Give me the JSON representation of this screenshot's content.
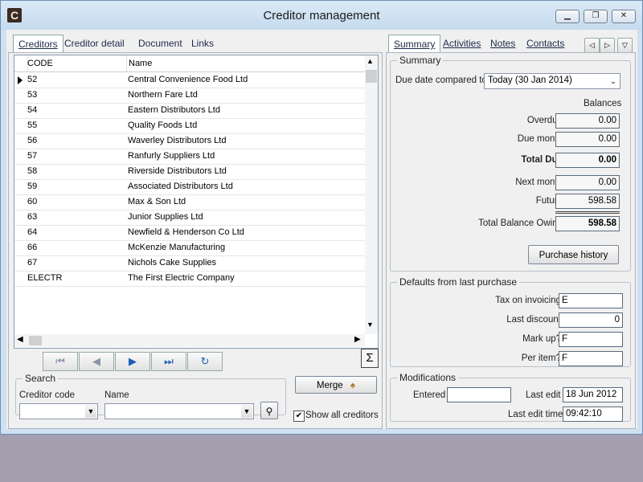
{
  "window": {
    "title": "Creditor management",
    "app_icon": "C",
    "icons": [
      "app-icon",
      "minimize-icon",
      "restore-icon",
      "close-icon"
    ]
  },
  "left_tabs": [
    "Creditors",
    "Creditor detail",
    "Document",
    "Links"
  ],
  "grid": {
    "columns": [
      "CODE",
      "Name"
    ],
    "rows": [
      {
        "code": "52",
        "name": "Central Convenience Food Ltd"
      },
      {
        "code": "53",
        "name": "Northern Fare Ltd"
      },
      {
        "code": "54",
        "name": "Eastern Distributors Ltd"
      },
      {
        "code": "55",
        "name": "Quality Foods Ltd"
      },
      {
        "code": "56",
        "name": "Waverley Distributors Ltd"
      },
      {
        "code": "57",
        "name": "Ranfurly Suppliers Ltd"
      },
      {
        "code": "58",
        "name": "Riverside Distributors Ltd"
      },
      {
        "code": "59",
        "name": "Associated Distributors Ltd"
      },
      {
        "code": "60",
        "name": "Max & Son Ltd"
      },
      {
        "code": "63",
        "name": "Junior Supplies Ltd"
      },
      {
        "code": "64",
        "name": "Newfield & Henderson Co Ltd"
      },
      {
        "code": "66",
        "name": "McKenzie Manufacturing"
      },
      {
        "code": "67",
        "name": "Nichols Cake Supplies"
      },
      {
        "code": "ELECTR",
        "name": "The First Electric Company"
      }
    ]
  },
  "nav": {
    "icons": [
      "first-record-icon",
      "previous-record-icon",
      "next-record-icon",
      "last-record-icon",
      "refresh-icon"
    ],
    "sigma": "Σ"
  },
  "search": {
    "legend": "Search",
    "code_label": "Creditor code",
    "name_label": "Name",
    "code_value": "",
    "name_value": ""
  },
  "merge_label": "Merge",
  "show_all": {
    "label": "Show all creditors",
    "checked": true
  },
  "right_tabs": [
    "Summary",
    "Activities",
    "Notes",
    "Contacts"
  ],
  "summary": {
    "legend": "Summary",
    "due_label": "Due date compared to",
    "due_value": "Today (30 Jan 2014)",
    "balances_label": "Balances",
    "overdue_label": "Overdue",
    "overdue": "0.00",
    "due_month_label": "Due month",
    "due_month": "0.00",
    "total_due_label": "Total Due",
    "total_due": "0.00",
    "next_month_label": "Next month",
    "next_month": "0.00",
    "future_label": "Future",
    "future": "598.58",
    "total_owing_label": "Total Balance Owing",
    "total_owing": "598.58",
    "purchase_history": "Purchase history"
  },
  "defaults": {
    "legend": "Defaults from last purchase",
    "tax_label": "Tax on invoicing",
    "tax": "E",
    "discount_label": "Last discount",
    "discount": "0",
    "markup_label": "Mark up?",
    "markup": "F",
    "peritem_label": "Per item?",
    "peritem": "F"
  },
  "modifications": {
    "legend": "Modifications",
    "entered_label": "Entered",
    "entered": "",
    "last_edit_label": "Last edit",
    "last_edit": "18 Jun 2012",
    "last_edit_time_label": "Last edit time",
    "last_edit_time": "09:42:10"
  }
}
